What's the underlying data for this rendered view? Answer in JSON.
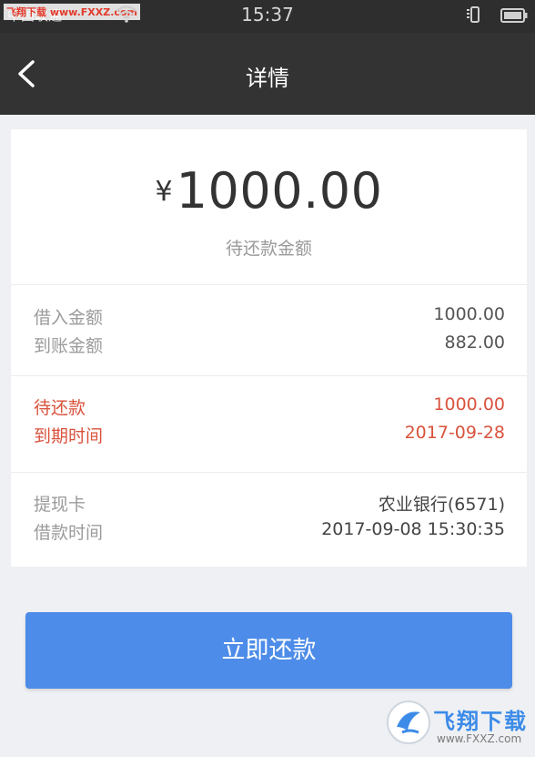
{
  "status_bar": {
    "carrier": "中国联通",
    "watermark": "飞翔下载 www.FXXZ.com",
    "time": "15:37"
  },
  "nav": {
    "title": "详情"
  },
  "summary": {
    "currency_symbol": "¥",
    "amount": "1000.00",
    "label": "待还款金额"
  },
  "details": {
    "borrow_amount_label": "借入金额",
    "borrow_amount_value": "1000.00",
    "received_amount_label": "到账金额",
    "received_amount_value": "882.00",
    "pending_label": "待还款",
    "pending_value": "1000.00",
    "due_date_label": "到期时间",
    "due_date_value": "2017-09-28",
    "card_label": "提现卡",
    "card_value": "农业银行(6571)",
    "loan_time_label": "借款时间",
    "loan_time_value": "2017-09-08 15:30:35"
  },
  "actions": {
    "repay_label": "立即还款"
  },
  "watermark": {
    "text": "飞翔下载",
    "url": "www.FXXZ.com"
  },
  "colors": {
    "accent_blue": "#4d8ce8",
    "alert_red": "#d9533d",
    "nav_dark": "#333333"
  }
}
